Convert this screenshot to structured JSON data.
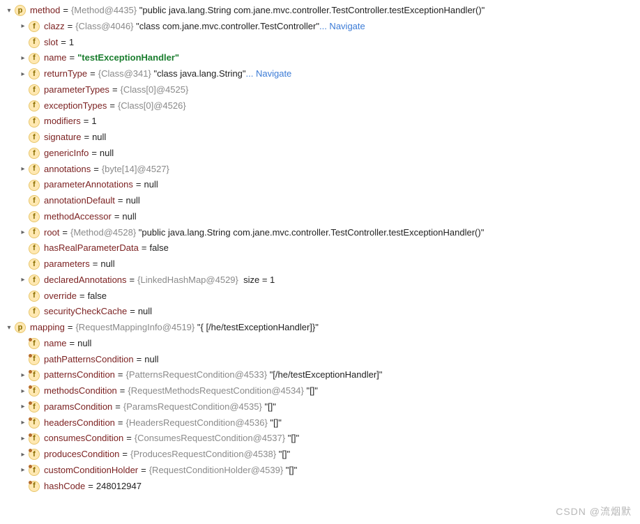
{
  "method": {
    "label": "method",
    "ref": "{Method@4435}",
    "value": "\"public java.lang.String com.jane.mvc.controller.TestController.testExceptionHandler()\"",
    "fields": {
      "clazz": {
        "label": "clazz",
        "ref": "{Class@4046}",
        "value": "\"class com.jane.mvc.controller.TestController\"",
        "nav": "... Navigate"
      },
      "slot": {
        "label": "slot",
        "value": "1"
      },
      "name": {
        "label": "name",
        "value": "\"testExceptionHandler\""
      },
      "returnType": {
        "label": "returnType",
        "ref": "{Class@341}",
        "value": "\"class java.lang.String\"",
        "nav": "... Navigate"
      },
      "parameterTypes": {
        "label": "parameterTypes",
        "ref": "{Class[0]@4525}"
      },
      "exceptionTypes": {
        "label": "exceptionTypes",
        "ref": "{Class[0]@4526}"
      },
      "modifiers": {
        "label": "modifiers",
        "value": "1"
      },
      "signature": {
        "label": "signature",
        "value": "null"
      },
      "genericInfo": {
        "label": "genericInfo",
        "value": "null"
      },
      "annotations": {
        "label": "annotations",
        "ref": "{byte[14]@4527}"
      },
      "parameterAnnotations": {
        "label": "parameterAnnotations",
        "value": "null"
      },
      "annotationDefault": {
        "label": "annotationDefault",
        "value": "null"
      },
      "methodAccessor": {
        "label": "methodAccessor",
        "value": "null"
      },
      "root": {
        "label": "root",
        "ref": "{Method@4528}",
        "value": "\"public java.lang.String com.jane.mvc.controller.TestController.testExceptionHandler()\""
      },
      "hasRealParameterData": {
        "label": "hasRealParameterData",
        "value": "false"
      },
      "parameters": {
        "label": "parameters",
        "value": "null"
      },
      "declaredAnnotations": {
        "label": "declaredAnnotations",
        "ref": "{LinkedHashMap@4529}",
        "extra": "size = 1"
      },
      "override": {
        "label": "override",
        "value": "false"
      },
      "securityCheckCache": {
        "label": "securityCheckCache",
        "value": "null"
      }
    }
  },
  "mapping": {
    "label": "mapping",
    "ref": "{RequestMappingInfo@4519}",
    "value": "\"{ [/he/testExceptionHandler]}\"",
    "fields": {
      "name": {
        "label": "name",
        "value": "null"
      },
      "pathPatternsCondition": {
        "label": "pathPatternsCondition",
        "value": "null"
      },
      "patternsCondition": {
        "label": "patternsCondition",
        "ref": "{PatternsRequestCondition@4533}",
        "value": "\"[/he/testExceptionHandler]\""
      },
      "methodsCondition": {
        "label": "methodsCondition",
        "ref": "{RequestMethodsRequestCondition@4534}",
        "value": "\"[]\""
      },
      "paramsCondition": {
        "label": "paramsCondition",
        "ref": "{ParamsRequestCondition@4535}",
        "value": "\"[]\""
      },
      "headersCondition": {
        "label": "headersCondition",
        "ref": "{HeadersRequestCondition@4536}",
        "value": "\"[]\""
      },
      "consumesCondition": {
        "label": "consumesCondition",
        "ref": "{ConsumesRequestCondition@4537}",
        "value": "\"[]\""
      },
      "producesCondition": {
        "label": "producesCondition",
        "ref": "{ProducesRequestCondition@4538}",
        "value": "\"[]\""
      },
      "customConditionHolder": {
        "label": "customConditionHolder",
        "ref": "{RequestConditionHolder@4539}",
        "value": "\"[]\""
      },
      "hashCode": {
        "label": "hashCode",
        "value": "248012947"
      }
    }
  },
  "watermark": "CSDN @流烟默"
}
